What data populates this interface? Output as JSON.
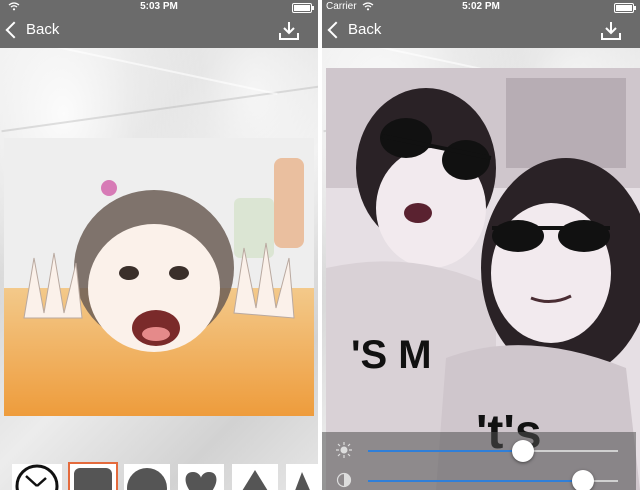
{
  "left": {
    "status": {
      "time": "5:03 PM"
    },
    "nav": {
      "back_label": "Back"
    },
    "shape_thumbs": [
      "clock-shape",
      "square-shape",
      "circle-shape",
      "heart-shape",
      "triangle-shape",
      "partial-shape"
    ],
    "selected_thumb": 1
  },
  "right": {
    "status": {
      "carrier": "Carrier",
      "time": "5:02 PM"
    },
    "nav": {
      "back_label": "Back"
    },
    "sliders": [
      {
        "name": "brightness",
        "icon": "sun-icon",
        "value": 0.62
      },
      {
        "name": "contrast",
        "icon": "contrast-icon",
        "value": 0.86
      }
    ]
  },
  "colors": {
    "bar": "#6b6b6b",
    "accent": "#2f7fd9",
    "selected": "#e46a3c"
  }
}
